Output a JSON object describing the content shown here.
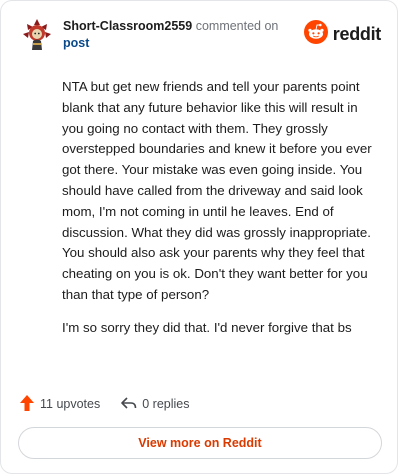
{
  "header": {
    "username": "Short-Classroom2559",
    "action_text": "commented on",
    "post_link": "post",
    "brand": "reddit",
    "avatar_icon": "snoo-avatar-icon",
    "logo_icon": "reddit-snoo-icon"
  },
  "comment": {
    "paragraphs": [
      "NTA but get new friends and tell your parents point blank that any future behavior like this will result in you going no contact with them. They grossly overstepped boundaries and knew it before you ever got there. Your mistake was even going inside. You should have called from the driveway and said look mom, I'm not coming in until he leaves. End of discussion. What they did was grossly inappropriate. You should also ask your parents why they feel that cheating on you is ok. Don't they want better for you than that type of person?",
      "I'm so sorry they did that. I'd never forgive that bs"
    ]
  },
  "footer": {
    "upvotes": "11 upvotes",
    "replies": "0 replies",
    "upvote_icon": "upvote-arrow-icon",
    "reply_icon": "reply-arrow-icon"
  },
  "cta": {
    "label": "View more on Reddit"
  },
  "colors": {
    "brand_orange": "#ff4500",
    "link": "#0a4a8a",
    "cta_text": "#d93a00",
    "border": "#e3e5e8"
  }
}
